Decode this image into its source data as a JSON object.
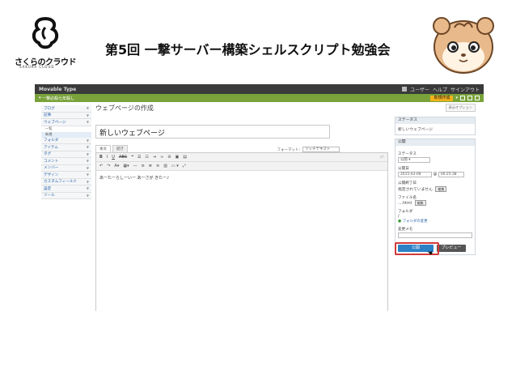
{
  "slide": {
    "logo_word": "さくらのクラウド",
    "logo_sub": "SAKURA CLOUD",
    "title": "第5回 一撃サーバー構築シェルスクリプト勉強会"
  },
  "app": {
    "brand": "Movable Type",
    "user_menu": "ユーザー",
    "help": "ヘルプ",
    "signout": "サインアウト",
    "site_name": "一撃必殺七年殺し",
    "new_button": "新規作成"
  },
  "sidebar": {
    "items": [
      {
        "label": "ブログ"
      },
      {
        "label": "記事"
      },
      {
        "label": "ウェブページ"
      }
    ],
    "sub_items": [
      {
        "label": "一覧",
        "active": false
      },
      {
        "label": "新規",
        "active": true
      }
    ],
    "more_items": [
      {
        "label": "フォルダ"
      },
      {
        "label": "アイテム"
      },
      {
        "label": "タグ"
      },
      {
        "label": "コメント"
      },
      {
        "label": "メンバー"
      },
      {
        "label": "デザイン"
      },
      {
        "label": "カスタムフィールド"
      },
      {
        "label": "設定"
      },
      {
        "label": "ツール"
      }
    ]
  },
  "main": {
    "heading": "ウェブページの作成",
    "title_value": "新しいウェブページ",
    "tab_body": "本文",
    "tab_more": "続き",
    "format_label": "フォーマット:",
    "format_value": "リッチテキスト",
    "editor_text": "あーたーらしーいー あーさが きたー♪"
  },
  "right": {
    "display_options": "表示オプション",
    "status_header": "ステータス",
    "status_text": "新しいウェブページ",
    "publish_header": "公開",
    "status_label": "ステータス",
    "status_value": "公開",
    "date_label": "公開日",
    "date_value": "2015-03-08",
    "time_value": "00:25:38",
    "end_label": "公開終了日",
    "end_value": "指定されていません",
    "edit_btn": "編集",
    "filename_label": "ファイル名",
    "filename_value": "....html",
    "folder_label": "フォルダ",
    "folder_value": "/",
    "folder_change": "フォルダの変更",
    "memo_label": "変更メモ",
    "publish_btn": "公開",
    "preview_btn": "プレビュー"
  }
}
